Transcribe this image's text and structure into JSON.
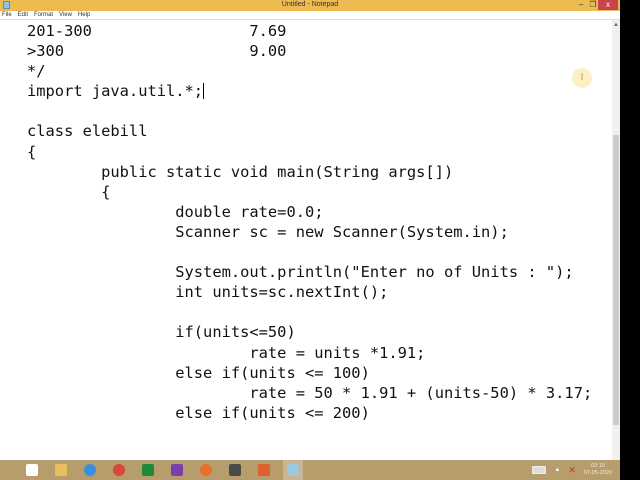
{
  "window": {
    "title": "Untitled - Notepad",
    "min": "–",
    "max": "❐",
    "close": "x"
  },
  "menu": [
    "File",
    "Edit",
    "Format",
    "View",
    "Help"
  ],
  "editor": {
    "lines": [
      "201-300                 7.69",
      ">300                    9.00",
      "*/",
      "import java.util.*;",
      "",
      "class elebill",
      "{",
      "        public static void main(String args[])",
      "        {",
      "                double rate=0.0;",
      "                Scanner sc = new Scanner(System.in);",
      "",
      "                System.out.println(\"Enter no of Units : \");",
      "                int units=sc.nextInt();",
      "",
      "                if(units<=50)",
      "                        rate = units *1.91;",
      "                else if(units <= 100)",
      "                        rate = 50 * 1.91 + (units-50) * 3.17;",
      "                else if(units <= 200)"
    ]
  },
  "taskbar": {
    "apps": [
      {
        "name": "start",
        "color": "#ffffff"
      },
      {
        "name": "file-explorer",
        "color": "#e8c060"
      },
      {
        "name": "internet-explorer",
        "color": "#3a8ee0"
      },
      {
        "name": "chrome",
        "color": "#d9463b"
      },
      {
        "name": "store",
        "color": "#1e8a3a"
      },
      {
        "name": "onenote",
        "color": "#7b3fa8"
      },
      {
        "name": "firefox",
        "color": "#e8702a"
      },
      {
        "name": "sublime",
        "color": "#4a4a4a"
      },
      {
        "name": "xampp",
        "color": "#e06030"
      },
      {
        "name": "notepad",
        "color": "#9cc8e0"
      }
    ],
    "time": "02:19",
    "date": "07-05-2020"
  }
}
